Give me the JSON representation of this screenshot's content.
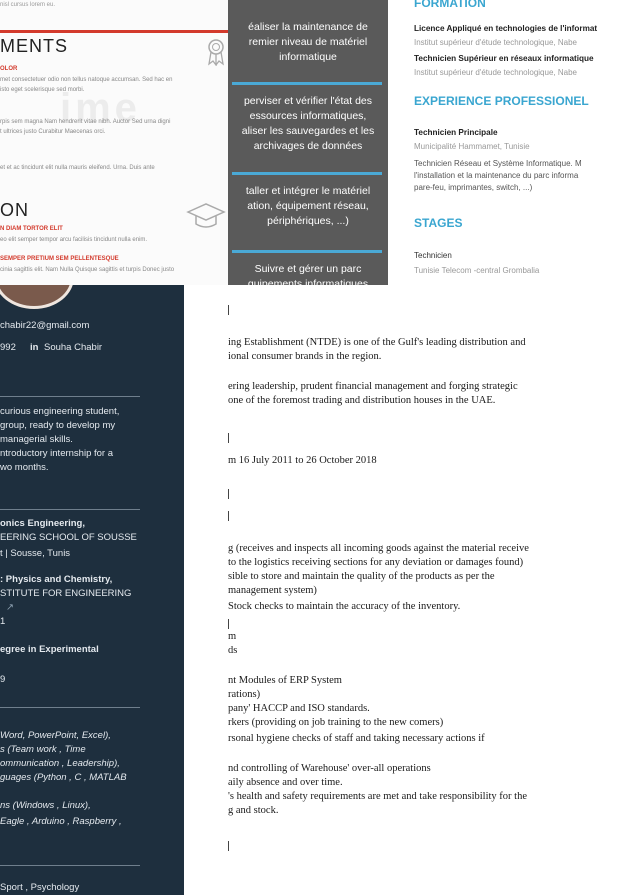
{
  "tileA": {
    "top_text": "nisl cursus lorem eu.",
    "heading1": "MENTS",
    "subhead1": "OLOR",
    "p1": "met consectetuer odio non tellus natoque accumsan. Sed hac en",
    "p1b": "isto eget scelerisque sed morbi.",
    "watermark": "ime",
    "p2": "rpis sem magna Nam hendrerit vitae nibh. Auctor Sed urna digni",
    "p2b": "t ultrices justo Curabitur Maecenas orci.",
    "p3": "et et ac tincidunt elit nulla mauris eleifend. Urna. Duis ante",
    "heading2": "ON",
    "subhead2": "N DIAM TORTOR ELIT",
    "p4": "eo elit semper tempor arcu facilisis tincidunt nulla enim.",
    "subhead3": "SEMPER PRETIUM SEM PELLENTESQUE",
    "p5": "cinia sagittis elit. Nam Nulla Quisque sagittis et turpis Donec justo"
  },
  "tileB": {
    "items": [
      "éaliser la maintenance de\nremier niveau de matériel\ninformatique",
      "perviser et vérifier l'état des\nessources informatiques,\naliser les sauvegardes et les\narchivages de données",
      "taller et intégrer le matériel\nation, équipement réseau,\npériphériques, ...)",
      "Suivre et gérer un parc\nquipements informatiques"
    ]
  },
  "tileC": {
    "formation_title": "FORMATION",
    "degree1": "Licence Appliqué en technologies de l'informat",
    "school1": "Institut supérieur d'étude technologique, Nabe",
    "degree2": "Technicien Supérieur en réseaux informatique",
    "school2": "Institut supérieur d'étude technologique, Nabe",
    "exp_title": "EXPERIENCE PROFESSIONEL",
    "job_title": "Technicien Principale",
    "job_place": "Municipalité Hammamet, Tunisie",
    "job_desc1": "Technicien Réseau et Système Informatique. M",
    "job_desc2": "l'installation et la maintenance du parc informa",
    "job_desc3": "pare-feu, imprimantes, switch, ...)",
    "stages_title": "STAGES",
    "stage_title": "Technicien",
    "stage_place": "Tunisie Telecom -central Grombalia"
  },
  "tileD": {
    "email": "chabir22@gmail.com",
    "phone": "992",
    "linkedin_icon": "in",
    "linkedin_name": "Souha Chabir",
    "profile": [
      "curious engineering student,",
      "group, ready to develop my",
      "managerial skills.",
      "ntroductory internship for a",
      "wo months."
    ],
    "edu1_title": "onics Engineering,",
    "edu1_school": "EERING SCHOOL OF SOUSSE",
    "edu1_place": "t | Sousse, Tunis",
    "edu2_title": ": Physics and Chemistry,",
    "edu2_school": "STITUTE FOR ENGINEERING",
    "edu2_icon": "link-icon",
    "edu2_year": "1",
    "edu3_title": "egree in Experimental",
    "edu3_year": "9",
    "skills1": "Word, PowerPoint, Excel),",
    "skills2": "s (Team work , Time",
    "skills3": "ommunication , Leadership),",
    "skills4": "guages (Python , C , MATLAB",
    "skills5": "ns (Windows , Linux),",
    "skills6": "Eagle , Arduino , Raspberry ,",
    "hobbies": "Sport , Psychology"
  },
  "tileE": {
    "lines": [
      "ing Establishment (NTDE) is one of the Gulf's leading distribution and",
      "ional consumer brands in the region.",
      "ering leadership, prudent financial management and forging strategic",
      "one of the foremost trading and distribution houses in the UAE.",
      "m 16 July 2011 to 26 October 2018",
      "g (receives and inspects all incoming goods against the material receive",
      "to the logistics receiving sections for any deviation or damages found)",
      "sible to store and maintain the quality of the products as per the",
      " management system)",
      "Stock checks to maintain the accuracy of the inventory.",
      "m",
      "ds",
      "nt Modules of ERP System",
      "rations)",
      "pany' HACCP and ISO standards.",
      "rkers (providing on job training to the new comers)",
      "rsonal hygiene checks of staff and taking necessary actions if",
      "nd controlling of Warehouse' over-all operations",
      "aily absence and over time.",
      "'s health and safety requirements are met and take responsibility for the",
      "g and stock."
    ]
  }
}
